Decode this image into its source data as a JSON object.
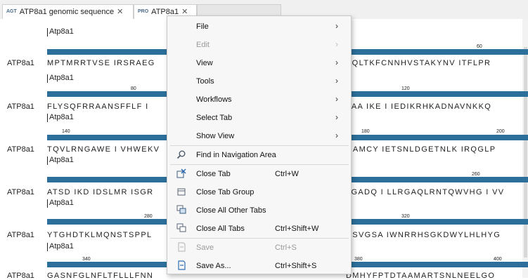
{
  "tabs": [
    {
      "icon": "AGT",
      "label": "ATP8a1 genomic sequence",
      "close": "✕"
    },
    {
      "icon": "PRO",
      "label": "ATP8a1",
      "close": "✕"
    },
    {
      "label": ""
    }
  ],
  "rows": [
    {
      "name": "ATP8a1",
      "annotation": "Atp8a1",
      "ticks": [
        "60"
      ],
      "seq_left": "MPTMRRTVSE IRSRAEG",
      "seq_right": "PQLTKFCNNHVSTAKYNV ITFLPR"
    },
    {
      "name": "ATP8a1",
      "annotation": "Atp8a1",
      "ticks": [
        "80",
        "120"
      ],
      "seq_left": "FLYSQFRRAANSFFLF I",
      "seq_right": "VAA IKE I IEDIKRHKADNAVNKKQ"
    },
    {
      "name": "ATP8a1",
      "annotation": "Atp8a1",
      "ticks": [
        "140",
        "180",
        "200"
      ],
      "seq_left": "TQVLRNGAWE I VHWEKV",
      "seq_right": "QAMCY IETSNLDGETNLK IRQGLP"
    },
    {
      "name": "ATP8a1",
      "annotation": "Atp8a1",
      "ticks": [
        "260"
      ],
      "seq_left": "ATSD IKD IDSLMR ISGR",
      "seq_right": "LGADQ I LLRGAQLRNTQWVHG I VV"
    },
    {
      "name": "ATP8a1",
      "annotation": "Atp8a1",
      "ticks": [
        "280",
        "320"
      ],
      "seq_left": "YTGHDTKLMQNSTSPPL",
      "seq_right": "CSVGSA IWNRRHSGKDWYLHLHYG"
    },
    {
      "name": "ATP8a1",
      "annotation": "Atp8a1",
      "ticks": [
        "340",
        "380",
        "400"
      ],
      "seq_left": "GASNFGLNFLTFLLLFNN",
      "seq_right": "DMHYFPTDTAAMARTSNLNEELGO"
    }
  ],
  "menu": {
    "items": [
      {
        "label": "File",
        "submenu": true
      },
      {
        "label": "Edit",
        "submenu": true,
        "disabled": true
      },
      {
        "label": "View",
        "submenu": true
      },
      {
        "label": "Tools",
        "submenu": true
      },
      {
        "label": "Workflows",
        "submenu": true
      },
      {
        "label": "Select Tab",
        "submenu": true
      },
      {
        "label": "Show View",
        "submenu": true
      },
      {
        "label": "Find in Navigation Area",
        "icon": "find-icon"
      },
      {
        "label": "Close Tab",
        "shortcut": "Ctrl+W",
        "icon": "close-tab-icon"
      },
      {
        "label": "Close Tab Group",
        "icon": "tab-group-icon"
      },
      {
        "label": "Close All Other Tabs",
        "icon": "tabs-icon"
      },
      {
        "label": "Close All Tabs",
        "shortcut": "Ctrl+Shift+W",
        "icon": "tabs-icon"
      },
      {
        "label": "Save",
        "shortcut": "Ctrl+S",
        "icon": "save-icon",
        "disabled": true
      },
      {
        "label": "Save As...",
        "shortcut": "Ctrl+Shift+S",
        "icon": "save-as-icon"
      }
    ],
    "arrow": "›"
  }
}
